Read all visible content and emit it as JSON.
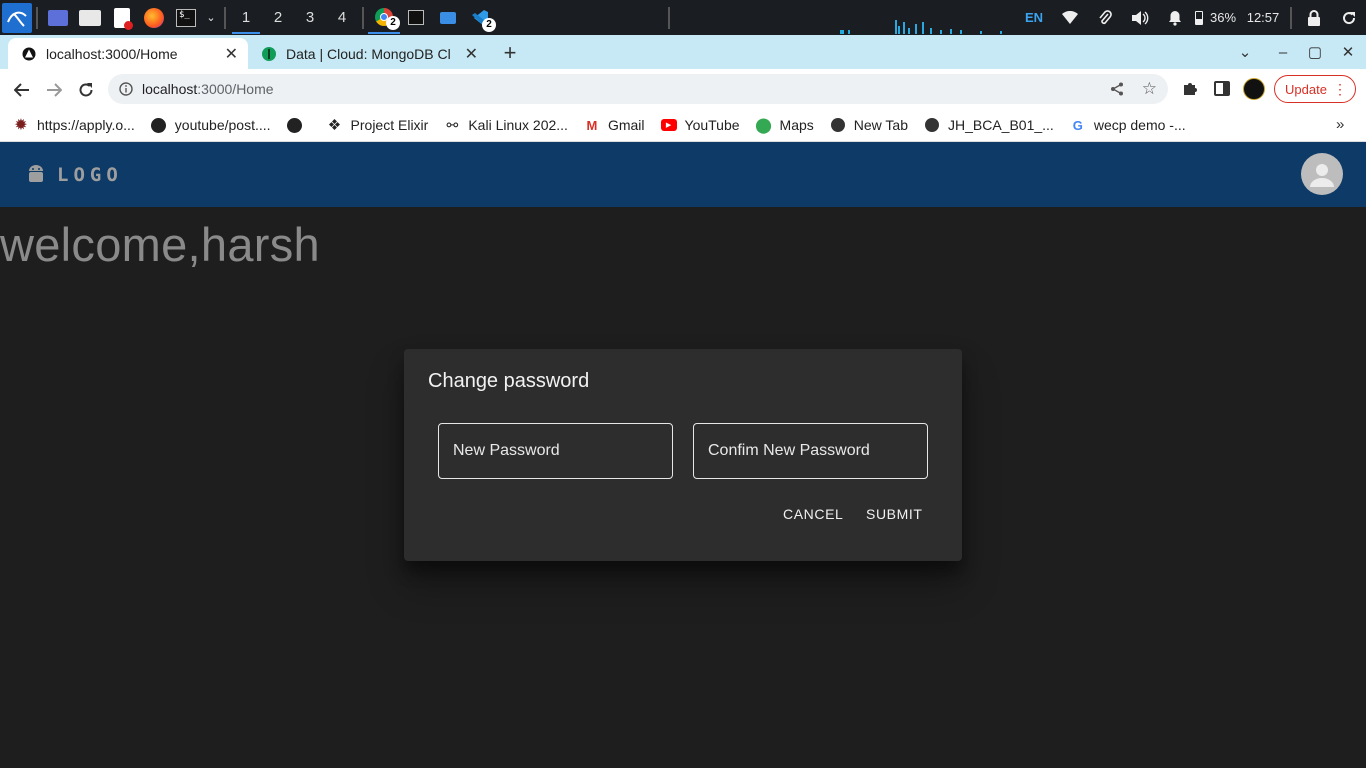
{
  "taskbar": {
    "workspaces": [
      "1",
      "2",
      "3",
      "4"
    ],
    "chrome_badge": "2",
    "vscode_badge": "2",
    "language": "EN",
    "battery": "36%",
    "time": "12:57"
  },
  "tabs": [
    {
      "title": "localhost:3000/Home"
    },
    {
      "title": "Data | Cloud: MongoDB Cl"
    }
  ],
  "address": {
    "host": "localhost",
    "path": ":3000/Home"
  },
  "update_label": "Update",
  "bookmarks": [
    "https://apply.o...",
    "youtube/post....",
    "Project Elixir",
    "Kali Linux 202...",
    "Gmail",
    "YouTube",
    "Maps",
    "New Tab",
    "JH_BCA_B01_...",
    "wecp demo -..."
  ],
  "app": {
    "logo_text": "LOGO",
    "welcome": "welcome,harsh"
  },
  "dialog": {
    "title": "Change password",
    "new_password_label": "New Password",
    "confirm_password_label": "Confim New Password",
    "cancel_label": "CANCEL",
    "submit_label": "SUBMIT"
  },
  "colors": {
    "appbar": "#0d3a66",
    "page_background": "#1e1e1e",
    "dialog_background": "#2d2d2d",
    "tabstrip": "#c7e9f5"
  }
}
